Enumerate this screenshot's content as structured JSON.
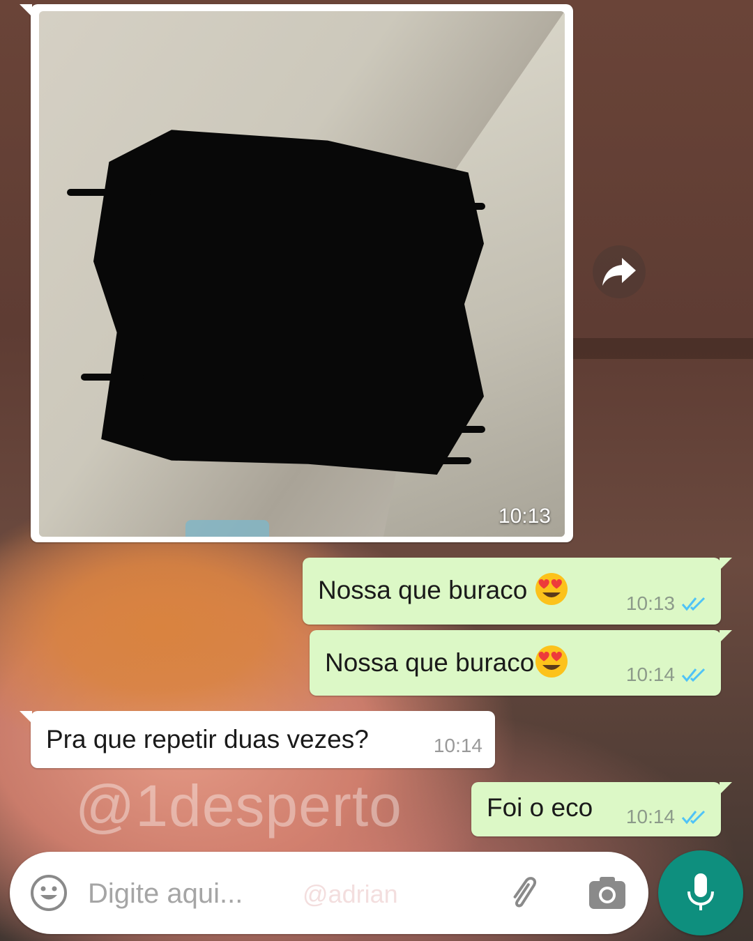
{
  "image_message": {
    "time": "10:13"
  },
  "messages": [
    {
      "direction": "out",
      "text": "Nossa que buraco",
      "emoji": "heart-eyes",
      "time": "10:13",
      "status": "read"
    },
    {
      "direction": "out",
      "text": "Nossa que buraco",
      "emoji": "heart-eyes",
      "time": "10:14",
      "status": "read"
    },
    {
      "direction": "in",
      "text": "Pra que repetir duas vezes?",
      "time": "10:14"
    },
    {
      "direction": "out",
      "text": "Foi o eco",
      "time": "10:14",
      "status": "read"
    }
  ],
  "watermark": "@1desperto",
  "input": {
    "placeholder": "Digite aqui...",
    "watermark": "@adrian"
  },
  "icons": {
    "forward": "forward-arrow-icon",
    "emoji": "smiley-icon",
    "attach": "paperclip-icon",
    "camera": "camera-icon",
    "mic": "microphone-icon",
    "ticks": "double-check-icon"
  },
  "colors": {
    "outgoing_bubble": "#dcf8c6",
    "incoming_bubble": "#ffffff",
    "read_ticks": "#4fc3f7",
    "mic_button": "#0e8f7e"
  }
}
